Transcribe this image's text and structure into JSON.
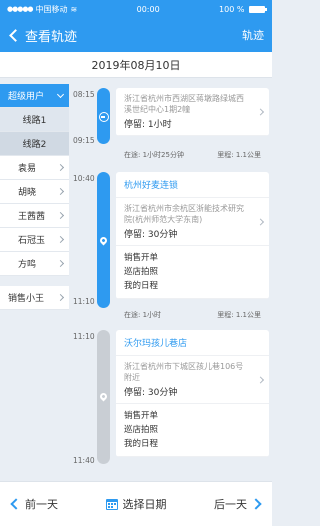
{
  "status_bar": {
    "carrier": "中国移动",
    "time": "00:00",
    "battery": "100 %"
  },
  "nav": {
    "back_label": "查看轨迹",
    "right_label": "轨迹"
  },
  "date": "2019年08月10日",
  "sidebar": {
    "group_label": "超级用户",
    "routes": [
      "线路1",
      "线路2"
    ],
    "people": [
      "袁易",
      "胡晓",
      "王茜茜",
      "石冠玉",
      "方鸣"
    ],
    "extra": "销售小王"
  },
  "timeline": [
    {
      "start": "08:15",
      "end": "09:15",
      "address": "浙江省杭州市西湖区蒋墩路绿城西溪世纪中心1期2幢",
      "stay": "停留: 1小时",
      "transit": "在途: 1小时25分钟",
      "distance": "里程: 1.1公里"
    },
    {
      "start": "10:40",
      "end": "11:10",
      "title": "杭州好麦连锁",
      "address": "浙江省杭州市余杭区浙能技术研究院(杭州师范大学东南)",
      "stay": "停留: 30分钟",
      "actions": [
        "销售开单",
        "巡店拍照",
        "我的日程"
      ],
      "transit": "在途: 1小时",
      "distance": "里程: 1.1公里"
    },
    {
      "start": "11:10",
      "end": "11:40",
      "title": "沃尔玛孩儿巷店",
      "address": "浙江省杭州市下城区孩儿巷106号附近",
      "stay": "停留: 30分钟",
      "actions": [
        "销售开单",
        "巡店拍照",
        "我的日程"
      ]
    }
  ],
  "bottom_bar": {
    "prev": "前一天",
    "pick": "选择日期",
    "next": "后一天"
  },
  "colors": {
    "accent": "#2e9af0",
    "gray_track": "#c9ced4"
  }
}
